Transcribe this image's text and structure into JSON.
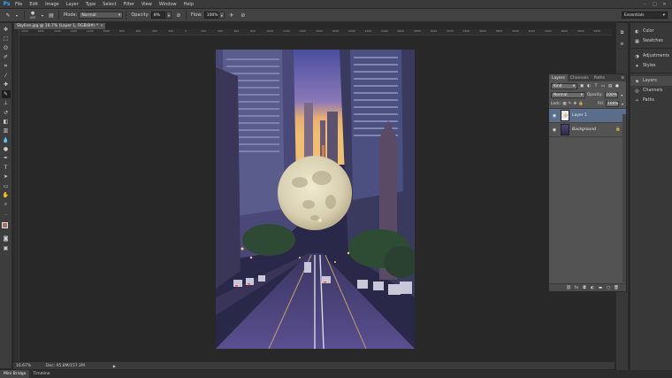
{
  "menubar": {
    "logo": "Ps",
    "items": [
      "File",
      "Edit",
      "Image",
      "Layer",
      "Type",
      "Select",
      "Filter",
      "View",
      "Window",
      "Help"
    ],
    "window_controls": [
      "–",
      "□",
      "✕"
    ]
  },
  "options": {
    "brush_size": "400",
    "mode_label": "Mode:",
    "mode_value": "Normal",
    "opacity_label": "Opacity:",
    "opacity_value": "8%",
    "flow_label": "Flow:",
    "flow_value": "100%",
    "workspace": "Essentials"
  },
  "document": {
    "tab_title": "Skyline.jpg @ 16.7% (Layer 1, RGB/8#) *",
    "close": "×"
  },
  "ruler": {
    "top_ticks": [
      "2000",
      "1800",
      "1600",
      "1400",
      "1200",
      "1000",
      "800",
      "600",
      "400",
      "200",
      "0",
      "200",
      "400",
      "600",
      "800",
      "1000",
      "1200",
      "1400",
      "1600",
      "1800",
      "2000",
      "2200",
      "2400",
      "2600",
      "2800",
      "3000",
      "3200",
      "3400",
      "3600",
      "3800",
      "4000",
      "4200",
      "4400",
      "4600",
      "4800",
      "5000"
    ]
  },
  "status": {
    "zoom": "16.67%",
    "doc": "Doc: 95.8M/157.2M",
    "arrow": "▶"
  },
  "bottom_tabs": [
    "Mini Bridge",
    "Timeline"
  ],
  "dock": {
    "group1": [
      {
        "label": "Color",
        "icon": "color-icon"
      },
      {
        "label": "Swatches",
        "icon": "swatches-icon"
      }
    ],
    "group2": [
      {
        "label": "Adjustments",
        "icon": "adjustments-icon"
      },
      {
        "label": "Styles",
        "icon": "styles-icon"
      }
    ],
    "group3": [
      {
        "label": "Layers",
        "icon": "layers-icon"
      },
      {
        "label": "Channels",
        "icon": "channels-icon"
      },
      {
        "label": "Paths",
        "icon": "paths-icon"
      }
    ]
  },
  "layers_panel": {
    "tabs": [
      "Layers",
      "Channels",
      "Paths"
    ],
    "filter_kind": "Kind",
    "blend_mode": "Normal",
    "opacity_label": "Opacity:",
    "opacity_value": "100%",
    "lock_label": "Lock:",
    "fill_label": "Fill:",
    "fill_value": "100%",
    "layers": [
      {
        "name": "Layer 1",
        "selected": true
      },
      {
        "name": "Background",
        "selected": false,
        "locked": true
      }
    ]
  }
}
